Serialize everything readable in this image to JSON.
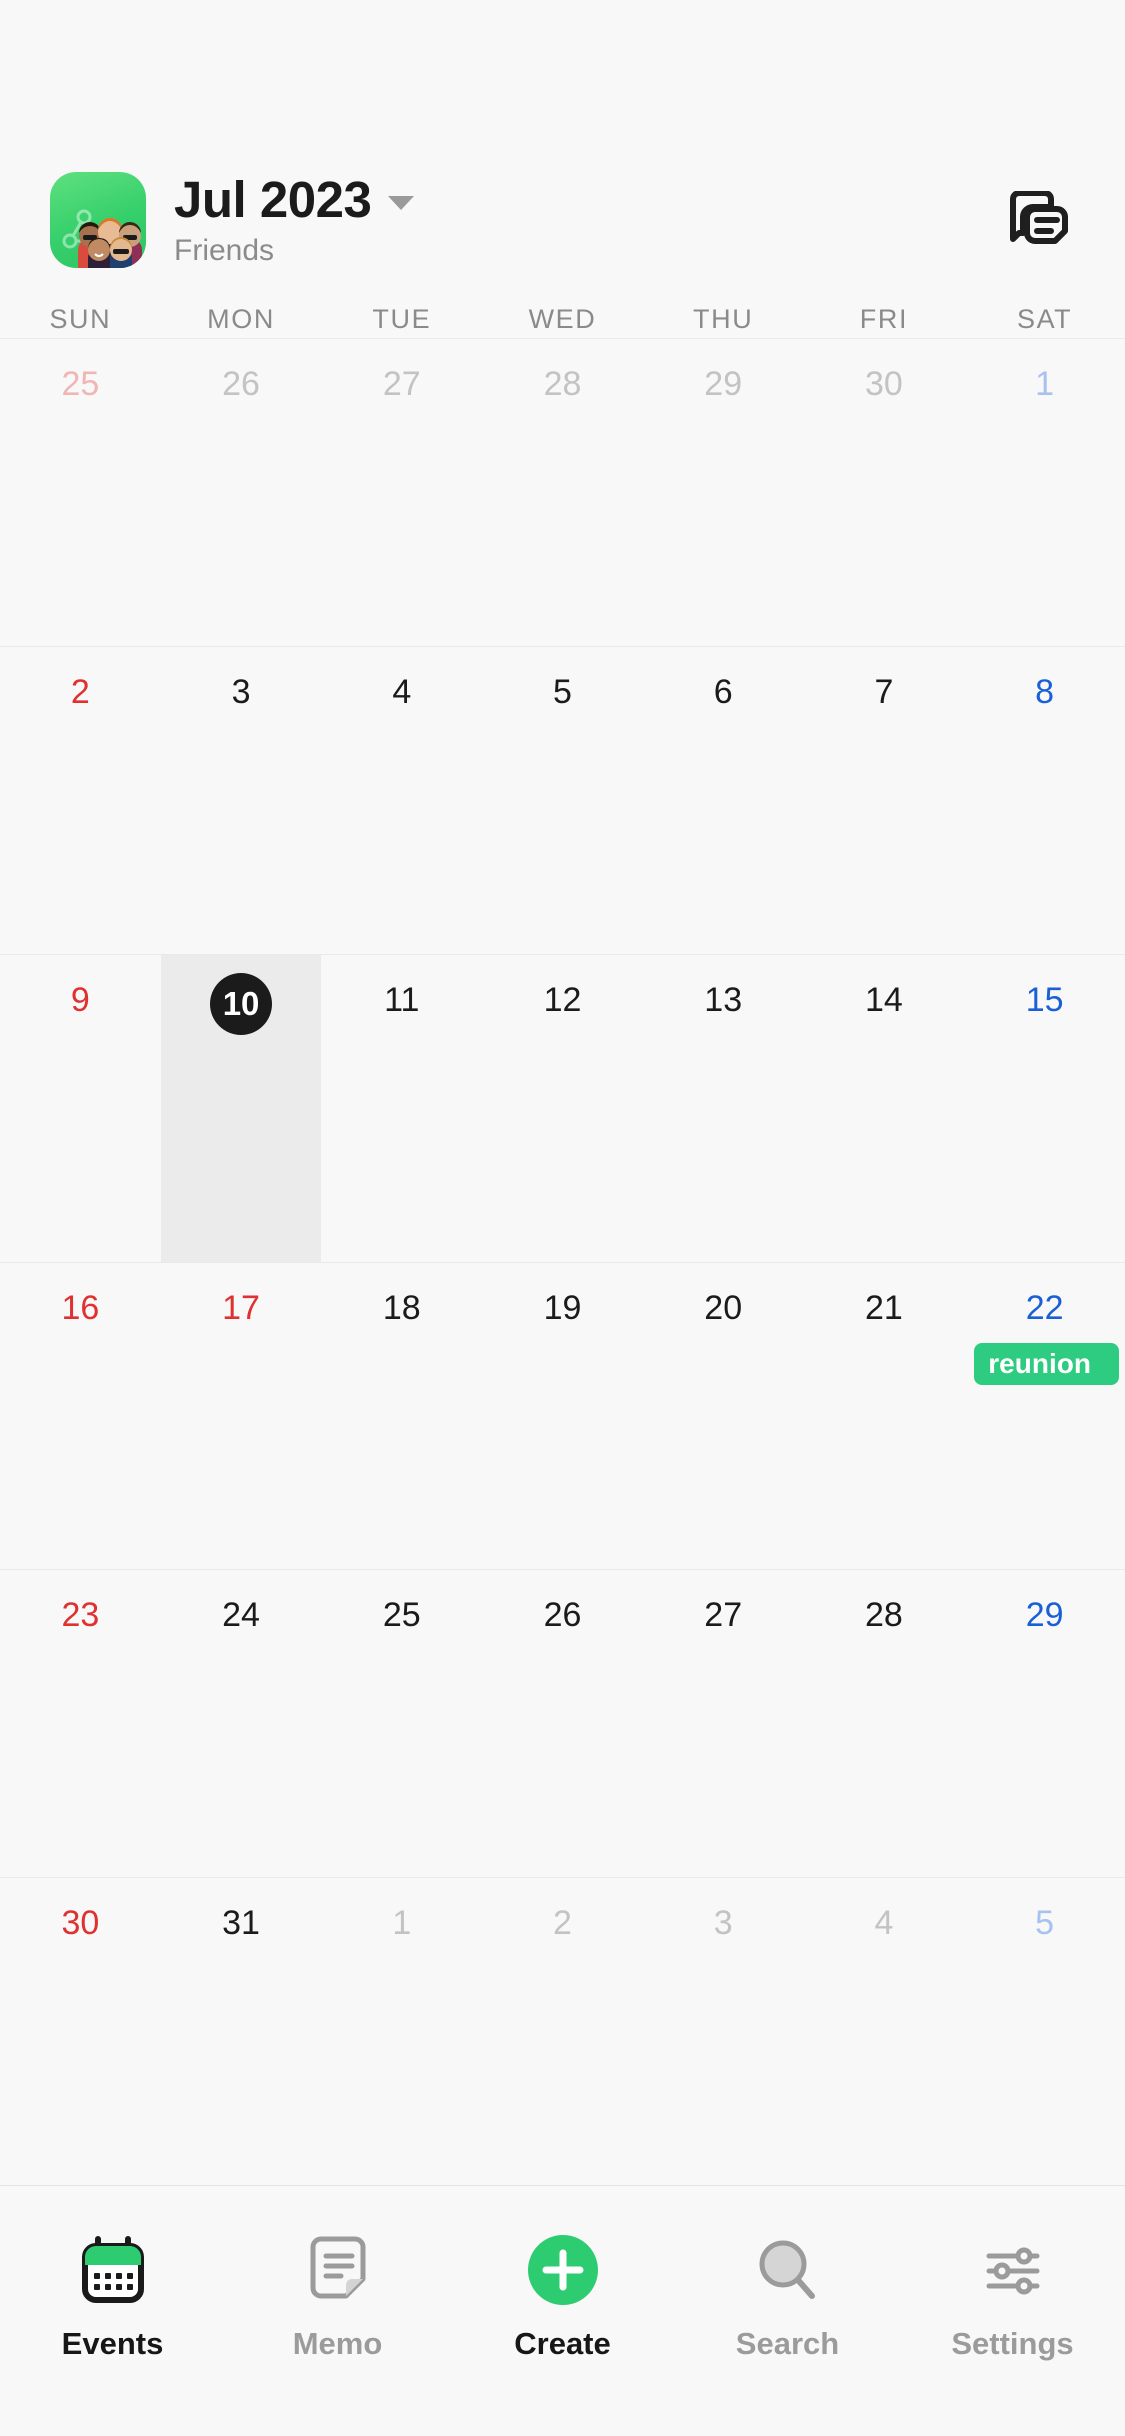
{
  "header": {
    "app_icon_name": "friends-group-icon",
    "title": "Jul 2023",
    "subtitle": "Friends",
    "caret_name": "chevron-down-icon",
    "notes_button_label": "notes-stack-icon"
  },
  "weekdays": [
    "SUN",
    "MON",
    "TUE",
    "WED",
    "THU",
    "FRI",
    "SAT"
  ],
  "colors": {
    "accent_green": "#2ECC71",
    "event_green": "#2ECC80",
    "sunday_red": "#E03131",
    "saturday_blue": "#1A5FD6",
    "today_bg": "#1B1B1B",
    "selected_cell_bg": "#EBEBEB",
    "page_bg": "#F8F8F8",
    "grid_line": "#E9E9E9"
  },
  "calendar": {
    "month_label": "Jul 2023",
    "selected_day": 10,
    "selected_column_index": 1,
    "weeks": [
      [
        {
          "num": "25",
          "kind": "out",
          "day_type": "sun"
        },
        {
          "num": "26",
          "kind": "out",
          "day_type": "weekday"
        },
        {
          "num": "27",
          "kind": "out",
          "day_type": "weekday"
        },
        {
          "num": "28",
          "kind": "out",
          "day_type": "weekday"
        },
        {
          "num": "29",
          "kind": "out",
          "day_type": "weekday"
        },
        {
          "num": "30",
          "kind": "out",
          "day_type": "weekday"
        },
        {
          "num": "1",
          "kind": "out",
          "day_type": "sat"
        }
      ],
      [
        {
          "num": "2",
          "kind": "in",
          "day_type": "sun"
        },
        {
          "num": "3",
          "kind": "in",
          "day_type": "weekday"
        },
        {
          "num": "4",
          "kind": "in",
          "day_type": "weekday"
        },
        {
          "num": "5",
          "kind": "in",
          "day_type": "weekday"
        },
        {
          "num": "6",
          "kind": "in",
          "day_type": "weekday"
        },
        {
          "num": "7",
          "kind": "in",
          "day_type": "weekday"
        },
        {
          "num": "8",
          "kind": "in",
          "day_type": "sat"
        }
      ],
      [
        {
          "num": "9",
          "kind": "in",
          "day_type": "sun"
        },
        {
          "num": "10",
          "kind": "in",
          "day_type": "today"
        },
        {
          "num": "11",
          "kind": "in",
          "day_type": "weekday"
        },
        {
          "num": "12",
          "kind": "in",
          "day_type": "weekday"
        },
        {
          "num": "13",
          "kind": "in",
          "day_type": "weekday"
        },
        {
          "num": "14",
          "kind": "in",
          "day_type": "weekday"
        },
        {
          "num": "15",
          "kind": "in",
          "day_type": "sat"
        }
      ],
      [
        {
          "num": "16",
          "kind": "in",
          "day_type": "sun"
        },
        {
          "num": "17",
          "kind": "in",
          "day_type": "holiday"
        },
        {
          "num": "18",
          "kind": "in",
          "day_type": "weekday"
        },
        {
          "num": "19",
          "kind": "in",
          "day_type": "weekday"
        },
        {
          "num": "20",
          "kind": "in",
          "day_type": "weekday"
        },
        {
          "num": "21",
          "kind": "in",
          "day_type": "weekday"
        },
        {
          "num": "22",
          "kind": "in",
          "day_type": "sat",
          "events": [
            {
              "title": "reunion",
              "color": "#2ECC80"
            }
          ]
        }
      ],
      [
        {
          "num": "23",
          "kind": "in",
          "day_type": "sun"
        },
        {
          "num": "24",
          "kind": "in",
          "day_type": "weekday"
        },
        {
          "num": "25",
          "kind": "in",
          "day_type": "weekday"
        },
        {
          "num": "26",
          "kind": "in",
          "day_type": "weekday"
        },
        {
          "num": "27",
          "kind": "in",
          "day_type": "weekday"
        },
        {
          "num": "28",
          "kind": "in",
          "day_type": "weekday"
        },
        {
          "num": "29",
          "kind": "in",
          "day_type": "sat"
        }
      ],
      [
        {
          "num": "30",
          "kind": "in",
          "day_type": "sun"
        },
        {
          "num": "31",
          "kind": "in",
          "day_type": "weekday"
        },
        {
          "num": "1",
          "kind": "out",
          "day_type": "weekday"
        },
        {
          "num": "2",
          "kind": "out",
          "day_type": "weekday"
        },
        {
          "num": "3",
          "kind": "out",
          "day_type": "weekday"
        },
        {
          "num": "4",
          "kind": "out",
          "day_type": "weekday"
        },
        {
          "num": "5",
          "kind": "out",
          "day_type": "sat"
        }
      ]
    ]
  },
  "tabbar": {
    "items": [
      {
        "label": "Events",
        "icon": "calendar-icon",
        "active": true
      },
      {
        "label": "Memo",
        "icon": "note-icon",
        "active": false
      },
      {
        "label": "Create",
        "icon": "plus-circle-icon",
        "active": false
      },
      {
        "label": "Search",
        "icon": "search-icon",
        "active": false
      },
      {
        "label": "Settings",
        "icon": "sliders-icon",
        "active": false
      }
    ]
  }
}
